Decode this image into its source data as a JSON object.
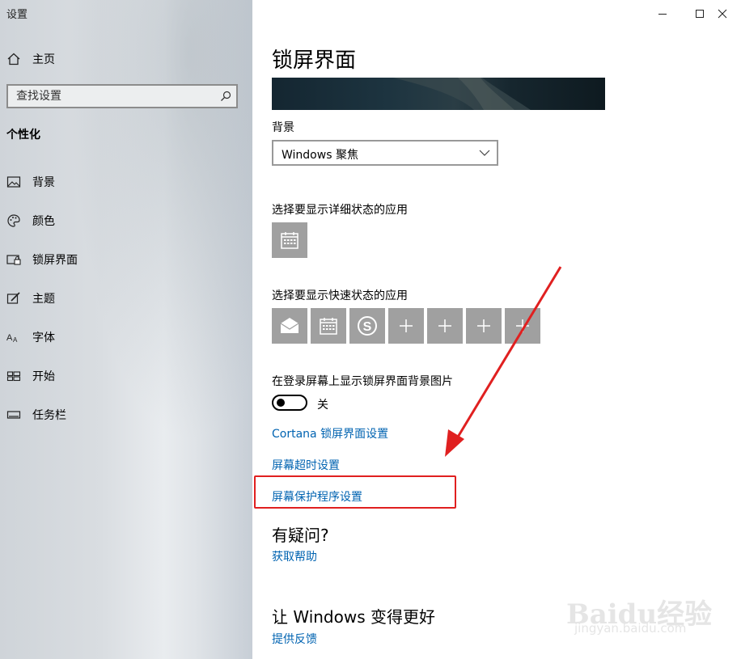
{
  "window": {
    "title": "设置"
  },
  "sidebar": {
    "home_label": "主页",
    "search_placeholder": "查找设置",
    "section_title": "个性化",
    "items": [
      {
        "label": "背景",
        "icon": "picture-icon"
      },
      {
        "label": "颜色",
        "icon": "palette-icon"
      },
      {
        "label": "锁屏界面",
        "icon": "lock-screen-icon"
      },
      {
        "label": "主题",
        "icon": "theme-icon"
      },
      {
        "label": "字体",
        "icon": "font-icon"
      },
      {
        "label": "开始",
        "icon": "start-icon"
      },
      {
        "label": "任务栏",
        "icon": "taskbar-icon"
      }
    ]
  },
  "main": {
    "title": "锁屏界面",
    "background_label": "背景",
    "background_value": "Windows 聚焦",
    "detailed_status_label": "选择要显示详细状态的应用",
    "quick_status_label": "选择要显示快速状态的应用",
    "quick_tiles": [
      "mail-icon",
      "calendar-icon",
      "skype-icon",
      "plus-icon",
      "plus-icon",
      "plus-icon",
      "plus-icon"
    ],
    "signin_bg_label": "在登录屏幕上显示锁屏界面背景图片",
    "signin_bg_state": "关",
    "links": {
      "cortana": "Cortana 锁屏界面设置",
      "timeout": "屏幕超时设置",
      "screensaver": "屏幕保护程序设置"
    },
    "question_heading": "有疑问?",
    "get_help": "获取帮助",
    "improve_heading": "让 Windows 变得更好",
    "feedback": "提供反馈"
  },
  "watermark": {
    "brand": "Baidu经验",
    "url": "jingyan.baidu.com"
  },
  "colors": {
    "link": "#0063b1",
    "highlight": "#e02020",
    "tile": "#a0a0a0"
  }
}
